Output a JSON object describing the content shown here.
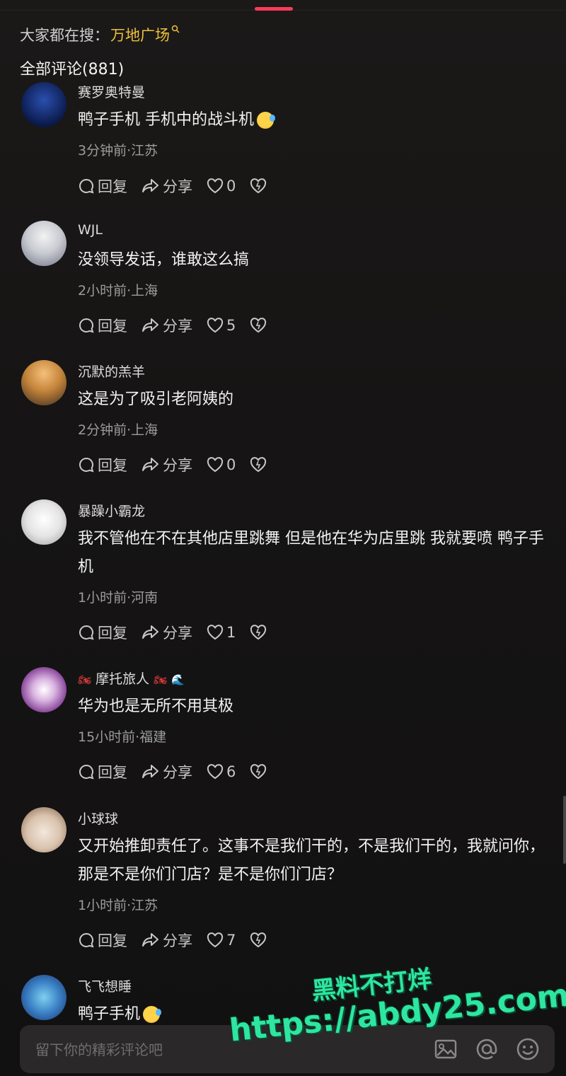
{
  "header": {
    "search_prefix": "大家都在搜：",
    "search_term": "万地广场",
    "comment_count_label": "全部评论(881)"
  },
  "comments": [
    {
      "user": "赛罗奥特曼",
      "text": "鸭子手机  手机中的战斗机",
      "emoji": "rolling-laughing-face",
      "meta": "3分钟前·江苏",
      "likes": "0"
    },
    {
      "user": "WJL",
      "text": "没领导发话，谁敢这么搞",
      "meta": "2小时前·上海",
      "likes": "5"
    },
    {
      "user": "沉默的羔羊",
      "text": "这是为了吸引老阿姨的",
      "meta": "2分钟前·上海",
      "likes": "0"
    },
    {
      "user": "暴躁小霸龙",
      "text": "我不管他在不在其他店里跳舞  但是他在华为店里跳  我就要喷  鸭子手机",
      "meta": "1小时前·河南",
      "likes": "1"
    },
    {
      "user": "摩托旅人",
      "text": "华为也是无所不用其极",
      "meta": "15小时前·福建",
      "likes": "6"
    },
    {
      "user": "小球球",
      "text": "又开始推卸责任了。这事不是我们干的，不是我们干的，我就问你，那是不是你们门店？是不是你们门店？",
      "meta": "1小时前·江苏",
      "likes": "7"
    },
    {
      "user": "飞飞想睡",
      "text": "鸭子手机",
      "emoji": "rolling-laughing-face"
    }
  ],
  "actions": {
    "reply": "回复",
    "share": "分享"
  },
  "input": {
    "placeholder": "留下你的精彩评论吧"
  },
  "icons": [
    "comment-icon",
    "share-icon",
    "heart-icon",
    "dislike-heart-icon",
    "image-icon",
    "at-icon",
    "emoji-icon"
  ],
  "watermark": {
    "line1": "黑料不打烊",
    "line2": "https://abdy25.com"
  },
  "colors": {
    "accent": "#ff3b5c",
    "search_term": "#f0c23b",
    "watermark": "#2ee6a0"
  }
}
